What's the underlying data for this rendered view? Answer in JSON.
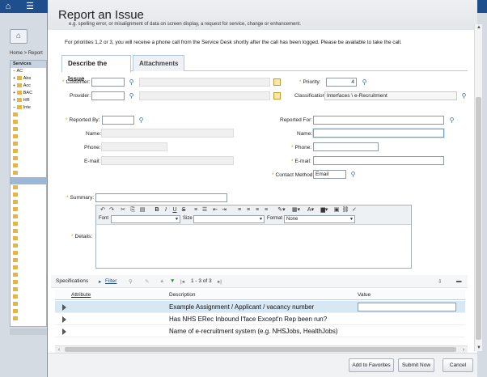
{
  "background": {
    "home_label": "Home",
    "breadcrumb": "Home > Report",
    "tree_items": [
      "Services",
      "AC",
      "Abs",
      "Acc",
      "BAC",
      "HR",
      "Inte"
    ]
  },
  "dialog": {
    "title": "Report an Issue",
    "clipped_text": "e.g. spelling error, or misalignment of data on screen display, a request for service, change or enhancement.",
    "info_text": "For priorities 1,2 or 3, you will receive a phone call from the Service Desk shortly after the call has been logged. Please be available to take the call.",
    "tabs": [
      {
        "label": "Describe the Issue",
        "active": true
      },
      {
        "label": "Attachments",
        "active": false
      }
    ],
    "customer_label": "Customer:",
    "provider_label": "Provider:",
    "priority_label": "Priority:",
    "priority_value": "4",
    "classification_label": "Classification:",
    "classification_value": "Interfaces \\ e-Recruitment",
    "reported_by_label": "Reported By:",
    "reported_for_label": "Reported For:",
    "name_label": "Name:",
    "phone_label": "Phone:",
    "email_label": "E-mail:",
    "contact_method_label": "Contact Method:",
    "contact_method_value": "Email",
    "summary_label": "Summary:",
    "details_label": "Details:"
  },
  "editor": {
    "font_label": "Font",
    "size_label": "Size",
    "format_label": "Format",
    "format_value": "None",
    "bold": "B",
    "italic": "I",
    "underline": "U",
    "strike": "S"
  },
  "specifications": {
    "title": "Specifications",
    "filter_label": "Filter",
    "pager": "1 - 3 of 3",
    "columns": [
      "Attribute",
      "Description",
      "Value"
    ],
    "rows": [
      {
        "description": "Example Assignment / Applicant / vacancy number"
      },
      {
        "description": "Has NHS ERec Inbound I'face Except'n Rep been run?"
      },
      {
        "description": "Name of e-recruitment system (e.g. NHSJobs, HealthJobs)"
      }
    ]
  },
  "footer": {
    "add_favorites": "Add to Favorites",
    "submit": "Submit Now",
    "cancel": "Cancel"
  },
  "colors": {
    "accent": "#1f4e8c",
    "required": "#e0a000",
    "row_highlight": "#d6e8f4"
  }
}
